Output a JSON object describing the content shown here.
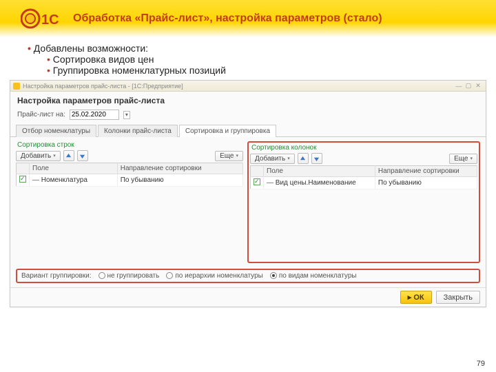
{
  "slide": {
    "title": "Обработка «Прайс-лист», настройка параметров (стало)",
    "page_number": "79",
    "bullets": {
      "main": "Добавлены возможности:",
      "sub1": "Сортировка видов цен",
      "sub2": "Группировка номенклатурных позиций"
    }
  },
  "window": {
    "titlebar": "Настройка параметров прайс-листа - [1С:Предприятие]",
    "heading": "Настройка параметров прайс-листа",
    "date_label": "Прайс-лист на:",
    "date_value": "25.02.2020",
    "tabs": {
      "t1": "Отбор номенклатуры",
      "t2": "Колонки прайс-листа",
      "t3": "Сортировка и группировка"
    },
    "left": {
      "title": "Сортировка строк",
      "add": "Добавить",
      "more": "Еще",
      "col_field": "Поле",
      "col_dir": "Направление сортировки",
      "row_field": "Номенклатура",
      "row_dir": "По убыванию"
    },
    "right": {
      "title": "Сортировка колонок",
      "add": "Добавить",
      "more": "Еще",
      "col_field": "Поле",
      "col_dir": "Направление сортировки",
      "row_field": "Вид цены.Наименование",
      "row_dir": "По убыванию"
    },
    "group": {
      "label": "Вариант группировки:",
      "opt1": "не группировать",
      "opt2": "по иерархии номенклатуры",
      "opt3": "по видам номенклатуры"
    },
    "footer": {
      "ok": "ОК",
      "close": "Закрыть"
    }
  }
}
